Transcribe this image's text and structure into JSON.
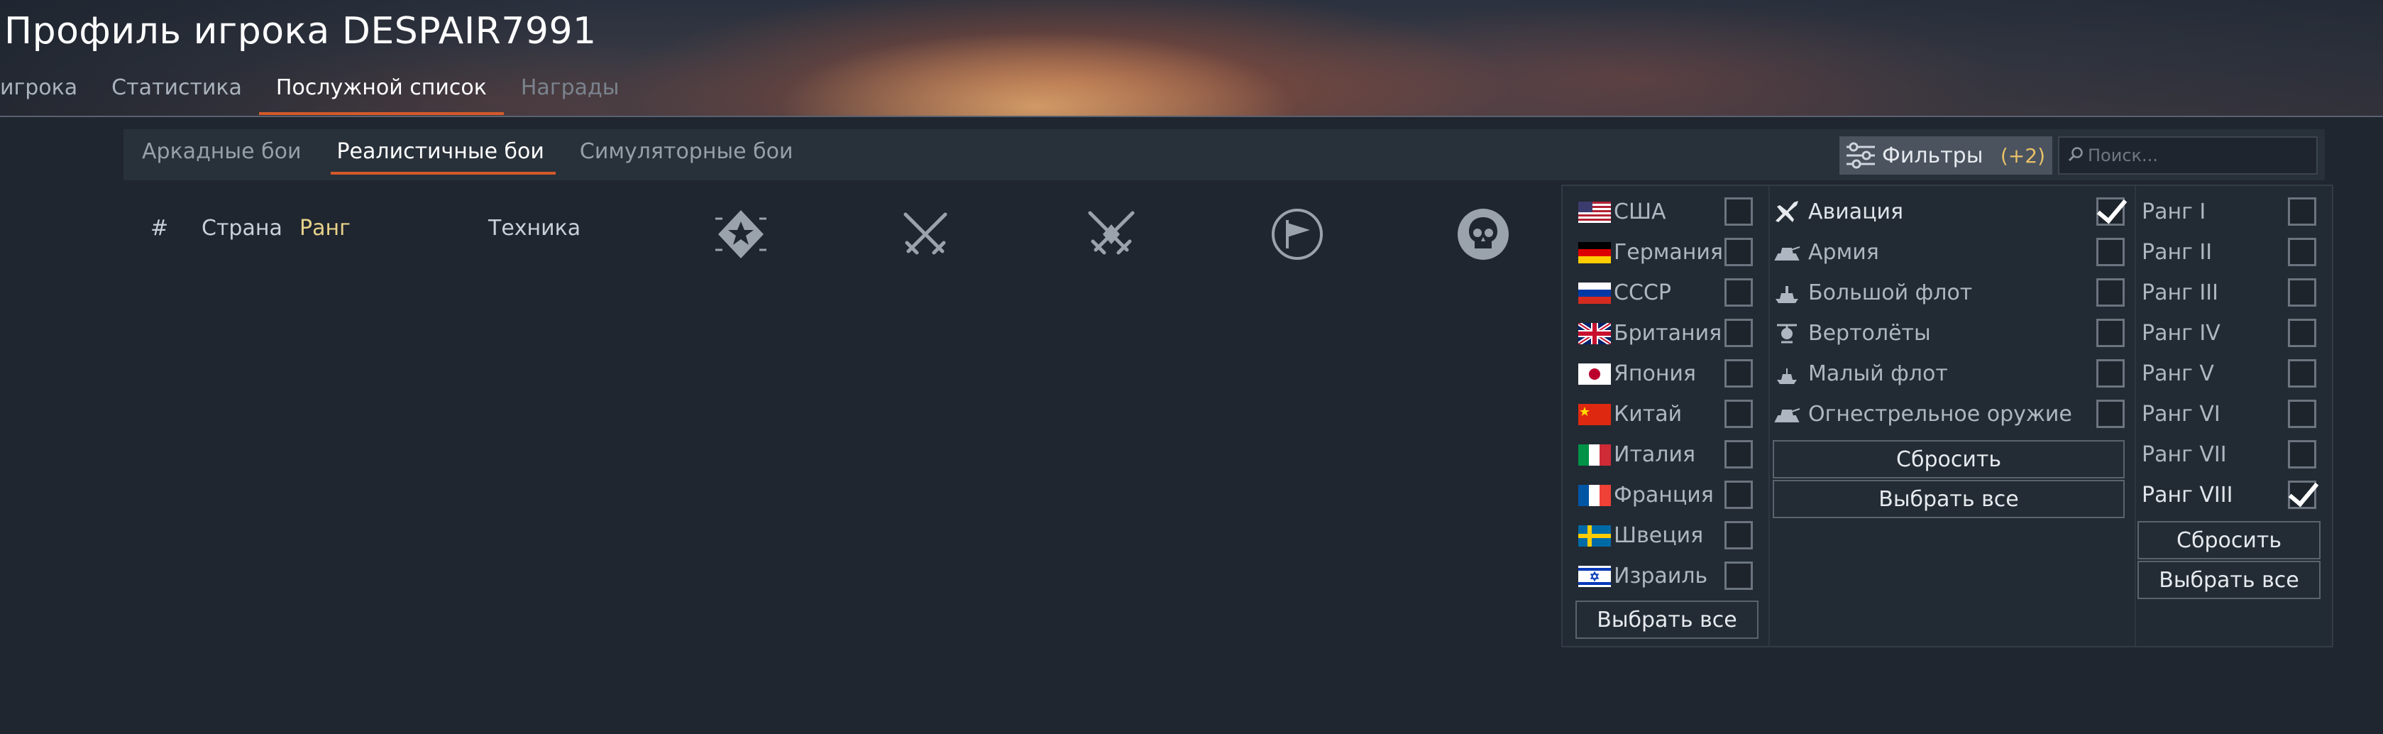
{
  "header": {
    "title": "Профиль игрока DESPAIR7991",
    "tabs": [
      {
        "label": "игрока",
        "state": "normal"
      },
      {
        "label": "Статистика",
        "state": "normal"
      },
      {
        "label": "Послужной список",
        "state": "active"
      },
      {
        "label": "Награды",
        "state": "dim"
      }
    ]
  },
  "mode_bar": {
    "tabs": [
      {
        "label": "Аркадные бои",
        "active": false
      },
      {
        "label": "Реалистичные бои",
        "active": true
      },
      {
        "label": "Симуляторные бои",
        "active": false
      }
    ],
    "filters_label": "Фильтры",
    "filters_count": "(+2)",
    "search_placeholder": "Поиск..."
  },
  "table_header": {
    "num": "#",
    "country": "Страна",
    "rank": "Ранг",
    "vehicle": "Техника",
    "icons": [
      "victories-icon",
      "swords-icon",
      "battles-icon",
      "flag-capture-icon",
      "kills-skull-icon"
    ]
  },
  "filter_panel": {
    "countries": [
      {
        "label": "США",
        "checked": false,
        "flag": "usa"
      },
      {
        "label": "Германия",
        "checked": false,
        "flag": "germany"
      },
      {
        "label": "СССР",
        "checked": false,
        "flag": "ussr"
      },
      {
        "label": "Британия",
        "checked": false,
        "flag": "britain"
      },
      {
        "label": "Япония",
        "checked": false,
        "flag": "japan"
      },
      {
        "label": "Китай",
        "checked": false,
        "flag": "china"
      },
      {
        "label": "Италия",
        "checked": false,
        "flag": "italy"
      },
      {
        "label": "Франция",
        "checked": false,
        "flag": "france"
      },
      {
        "label": "Швеция",
        "checked": false,
        "flag": "sweden"
      },
      {
        "label": "Израиль",
        "checked": false,
        "flag": "israel"
      }
    ],
    "country_select_all": "Выбрать все",
    "types": [
      {
        "label": "Авиация",
        "checked": true,
        "icon": "plane-icon"
      },
      {
        "label": "Армия",
        "checked": false,
        "icon": "tank-icon"
      },
      {
        "label": "Большой флот",
        "checked": false,
        "icon": "large-ship-icon"
      },
      {
        "label": "Вертолёты",
        "checked": false,
        "icon": "helicopter-icon"
      },
      {
        "label": "Малый флот",
        "checked": false,
        "icon": "small-ship-icon"
      },
      {
        "label": "Огнестрельное оружие",
        "checked": false,
        "icon": "firearm-icon"
      }
    ],
    "type_reset": "Сбросить",
    "type_select_all": "Выбрать все",
    "ranks": [
      {
        "label": "Ранг I",
        "checked": false
      },
      {
        "label": "Ранг II",
        "checked": false
      },
      {
        "label": "Ранг III",
        "checked": false
      },
      {
        "label": "Ранг IV",
        "checked": false
      },
      {
        "label": "Ранг V",
        "checked": false
      },
      {
        "label": "Ранг VI",
        "checked": false
      },
      {
        "label": "Ранг VII",
        "checked": false
      },
      {
        "label": "Ранг VIII",
        "checked": true
      }
    ],
    "rank_reset": "Сбросить",
    "rank_select_all": "Выбрать все"
  }
}
